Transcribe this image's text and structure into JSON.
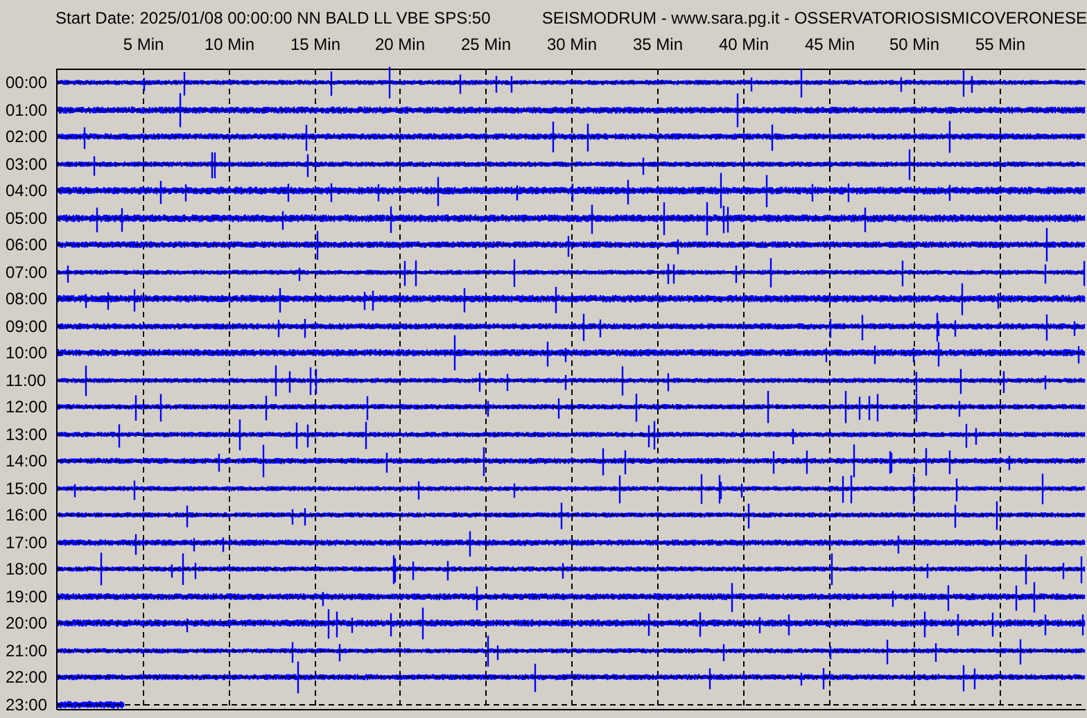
{
  "header": {
    "start": "Start Date: 2025/01/08 00:00:00 NN BALD LL VBE SPS:50",
    "source": "SEISMODRUM - www.sara.pg.it - OSSERVATORIOSISMICOVERONESE"
  },
  "minute_labels": [
    "5 Min",
    "10 Min",
    "15 Min",
    "20 Min",
    "25 Min",
    "30 Min",
    "35 Min",
    "40 Min",
    "45 Min",
    "50 Min",
    "55 Min"
  ],
  "rows": [
    {
      "label": "00:00",
      "level": 1
    },
    {
      "label": "01:00",
      "level": 1
    },
    {
      "label": "02:00",
      "level": 1
    },
    {
      "label": "03:00",
      "level": 1
    },
    {
      "label": "04:00",
      "level": 1
    },
    {
      "label": "05:00",
      "level": 1
    },
    {
      "label": "06:00",
      "level": 1
    },
    {
      "label": "07:00",
      "level": 1
    },
    {
      "label": "08:00",
      "level": 1
    },
    {
      "label": "09:00",
      "level": 1
    },
    {
      "label": "10:00",
      "level": 1
    },
    {
      "label": "11:00",
      "level": 1
    },
    {
      "label": "12:00",
      "level": 1
    },
    {
      "label": "13:00",
      "level": 1
    },
    {
      "label": "14:00",
      "level": 1
    },
    {
      "label": "15:00",
      "level": 1
    },
    {
      "label": "16:00",
      "level": 1
    },
    {
      "label": "17:00",
      "level": 1
    },
    {
      "label": "18:00",
      "level": 1
    },
    {
      "label": "19:00",
      "level": 1
    },
    {
      "label": "20:00",
      "level": 1
    },
    {
      "label": "21:00",
      "level": 1
    },
    {
      "label": "22:00",
      "level": 1
    },
    {
      "label": "23:00",
      "level": 0.066
    }
  ]
}
